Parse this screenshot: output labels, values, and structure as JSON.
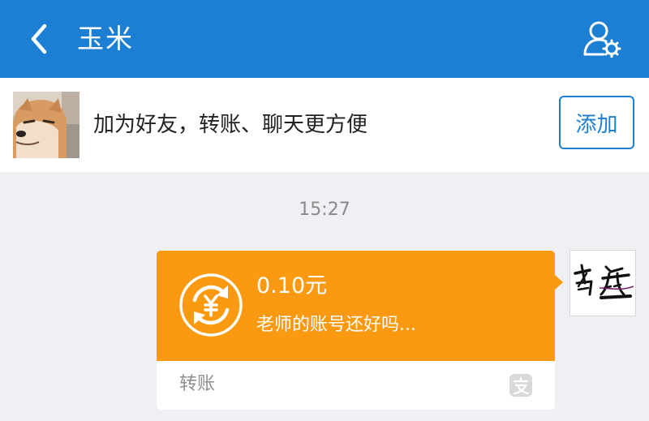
{
  "header": {
    "title": "玉米",
    "back_icon": "chevron-left-icon",
    "profile_icon": "user-settings-icon",
    "background": "#1c7fd3"
  },
  "add_friend_bar": {
    "avatar_icon": "shiba-dog-avatar",
    "prompt_text": "加为好友，转账、聊天更方便",
    "add_button_label": "添加"
  },
  "chat": {
    "timestamp": "15:27",
    "transfer_message": {
      "amount": "0.10元",
      "note": "老师的账号还好吗...",
      "footer_label": "转账",
      "icon": "yuan-exchange-icon",
      "brand_icon": "alipay-icon",
      "accent_color": "#fb9a10"
    },
    "sender_avatar": {
      "icon": "calligraphy-avatar"
    }
  }
}
